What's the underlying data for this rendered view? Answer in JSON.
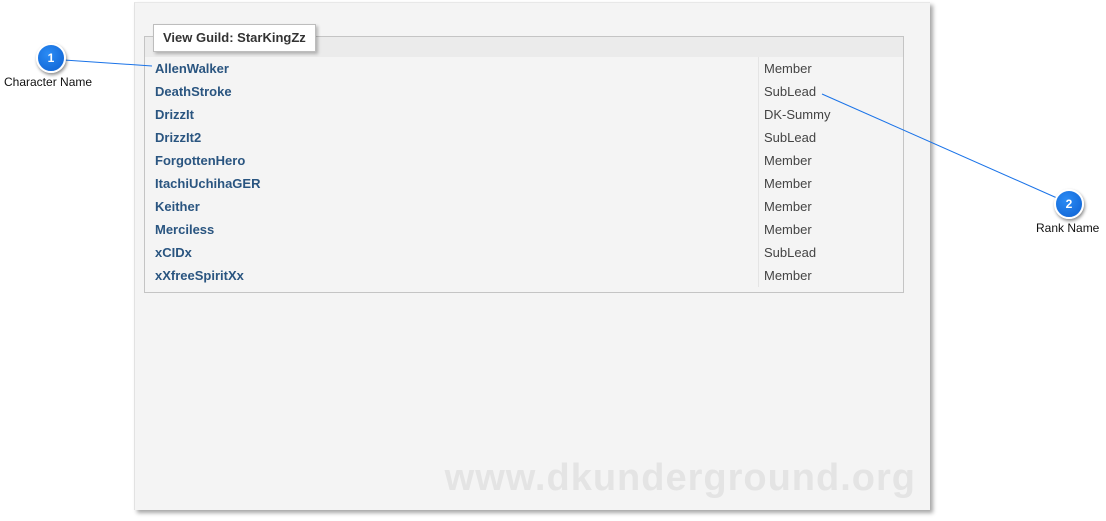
{
  "panel": {
    "title": "View Guild: StarKingZz",
    "watermark": "www.dkunderground.org"
  },
  "roster": [
    {
      "name": "AllenWalker",
      "rank": "Member"
    },
    {
      "name": "DeathStroke",
      "rank": "SubLead"
    },
    {
      "name": "DrizzIt",
      "rank": "DK-Summy"
    },
    {
      "name": "DrizzIt2",
      "rank": "SubLead"
    },
    {
      "name": "ForgottenHero",
      "rank": "Member"
    },
    {
      "name": "ItachiUchihaGER",
      "rank": "Member"
    },
    {
      "name": "Keither",
      "rank": "Member"
    },
    {
      "name": "Merciless",
      "rank": "Member"
    },
    {
      "name": "xCIDx",
      "rank": "SubLead"
    },
    {
      "name": "xXfreeSpiritXx",
      "rank": "Member"
    }
  ],
  "callouts": [
    {
      "number": "1",
      "label": "Character Name"
    },
    {
      "number": "2",
      "label": "Rank Name"
    }
  ],
  "colors": {
    "link": "#2a5580",
    "badge": "#1a73e8"
  }
}
